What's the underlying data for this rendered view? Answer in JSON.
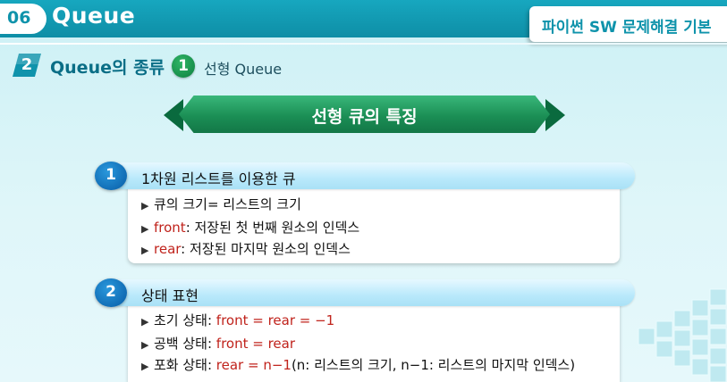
{
  "header": {
    "chapter_number": "06",
    "chapter_title": "Queue",
    "course_title": "파이썬 SW 문제해결 기본"
  },
  "section": {
    "number": "2",
    "title": "Queue의 종류",
    "sub_number": "1",
    "sub_title": "선형 Queue"
  },
  "ribbon": {
    "title": "선형 큐의 특징"
  },
  "cards": [
    {
      "number": "1",
      "title": "1차원 리스트를 이용한 큐",
      "bullets": [
        {
          "label": "큐의 크기= 리스트의 크기",
          "accent": "",
          "rest": ""
        },
        {
          "label": "",
          "accent": "front",
          "rest": ": 저장된 첫 번째 원소의 인덱스"
        },
        {
          "label": "",
          "accent": "rear",
          "rest": ": 저장된 마지막 원소의 인덱스"
        }
      ]
    },
    {
      "number": "2",
      "title": "상태 표현",
      "bullets": [
        {
          "label": "초기 상태: ",
          "accent": "front = rear = −1",
          "rest": ""
        },
        {
          "label": "공백 상태: ",
          "accent": "front = rear",
          "rest": ""
        },
        {
          "label": "포화 상태: ",
          "accent": "rear = n−1",
          "rest": "(n: 리스트의 크기, n−1: 리스트의 마지막 인덱스)"
        }
      ]
    }
  ],
  "icons": {
    "bullet": "triangle-bullet-icon"
  },
  "colors": {
    "banner": "#0f93ab",
    "ribbon": "#1b8f55",
    "accent_text": "#c0231c",
    "card_number": "#0c64ad"
  }
}
